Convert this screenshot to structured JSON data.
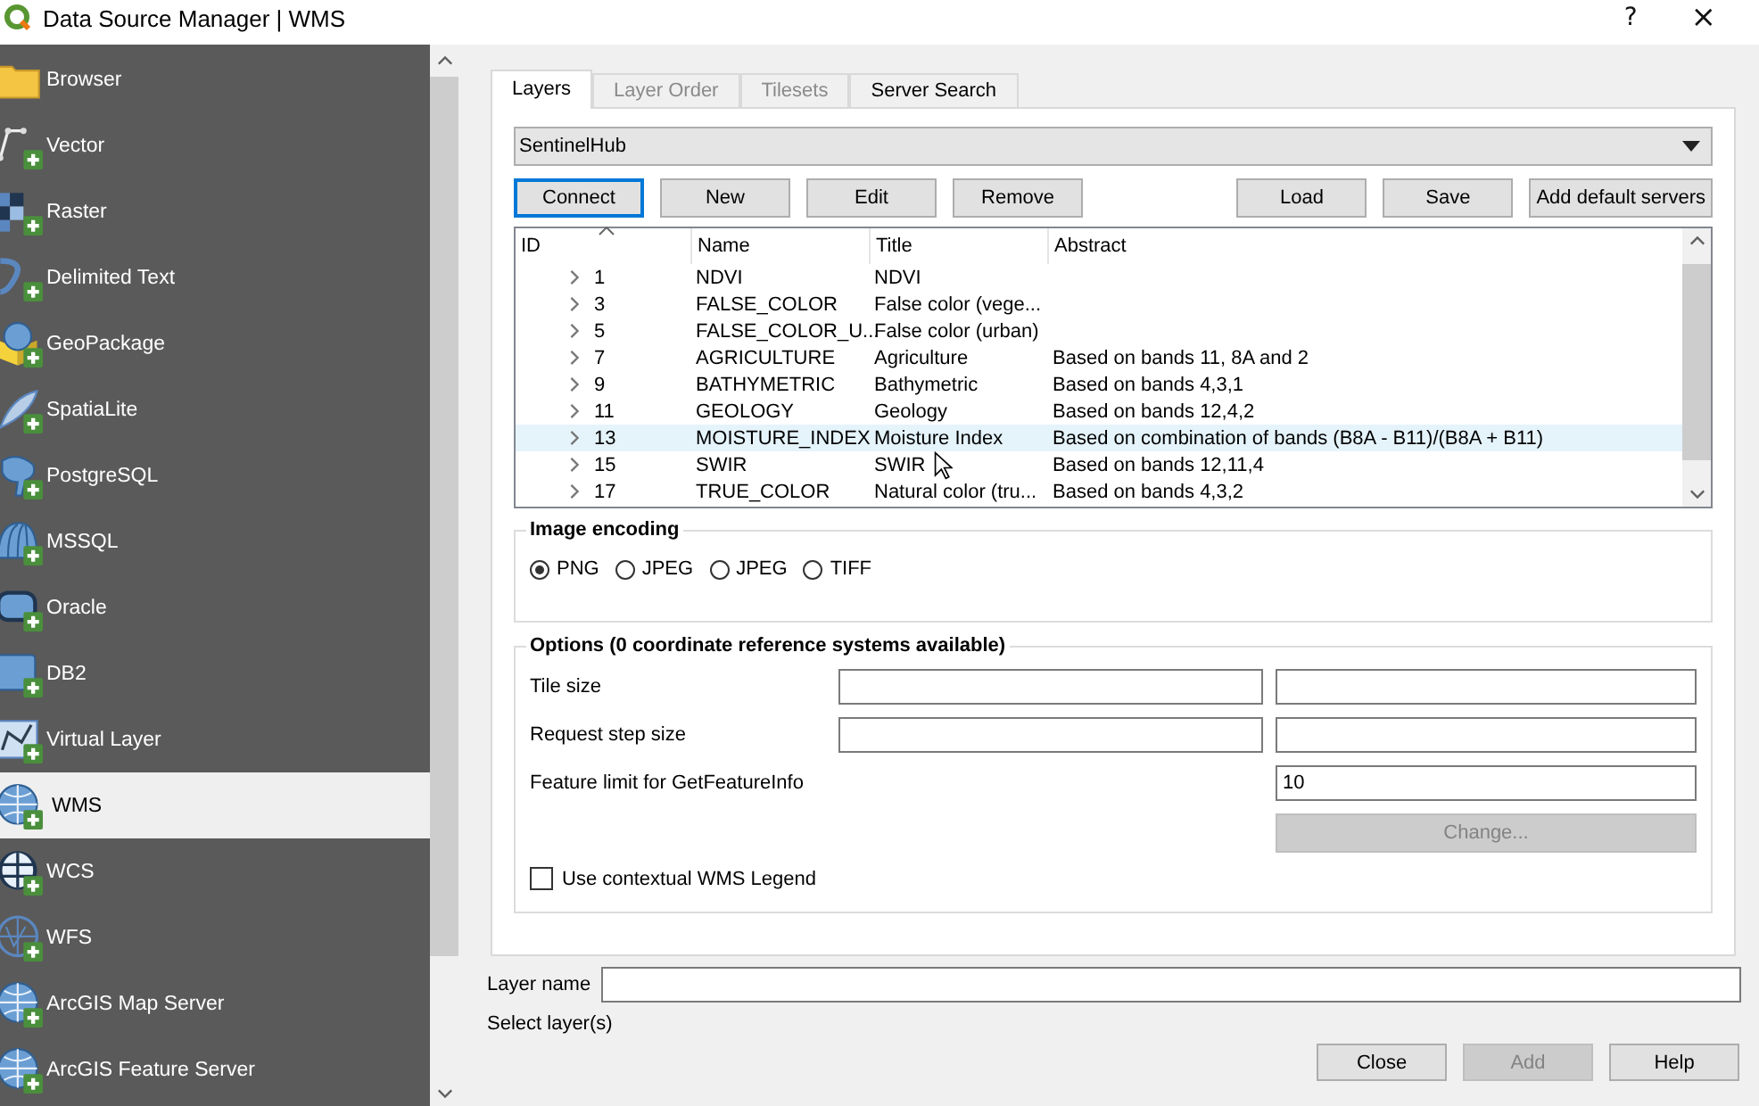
{
  "window": {
    "title": "Data Source Manager | WMS",
    "help": "?",
    "close": "×"
  },
  "sidebar": {
    "items": [
      {
        "label": "Browser",
        "selected": false
      },
      {
        "label": "Vector",
        "selected": false
      },
      {
        "label": "Raster",
        "selected": false
      },
      {
        "label": "Delimited Text",
        "selected": false
      },
      {
        "label": "GeoPackage",
        "selected": false
      },
      {
        "label": "SpatiaLite",
        "selected": false
      },
      {
        "label": "PostgreSQL",
        "selected": false
      },
      {
        "label": "MSSQL",
        "selected": false
      },
      {
        "label": "Oracle",
        "selected": false
      },
      {
        "label": "DB2",
        "selected": false
      },
      {
        "label": "Virtual Layer",
        "selected": false
      },
      {
        "label": "WMS",
        "selected": true
      },
      {
        "label": "WCS",
        "selected": false
      },
      {
        "label": "WFS",
        "selected": false
      },
      {
        "label": "ArcGIS Map Server",
        "selected": false
      },
      {
        "label": "ArcGIS Feature Server",
        "selected": false
      }
    ]
  },
  "tabs": [
    {
      "label": "Layers",
      "selected": true,
      "disabled": false
    },
    {
      "label": "Layer Order",
      "selected": false,
      "disabled": true
    },
    {
      "label": "Tilesets",
      "selected": false,
      "disabled": true
    },
    {
      "label": "Server Search",
      "selected": false,
      "disabled": false
    }
  ],
  "connection": {
    "value": "SentinelHub"
  },
  "connection_buttons": [
    {
      "label": "Connect",
      "focused": true
    },
    {
      "label": "New",
      "focused": false
    },
    {
      "label": "Edit",
      "focused": false
    },
    {
      "label": "Remove",
      "focused": false
    }
  ],
  "server_buttons": [
    {
      "label": "Load",
      "focused": false
    },
    {
      "label": "Save",
      "focused": false
    },
    {
      "label": "Add default servers",
      "focused": false
    }
  ],
  "layers_table": {
    "columns": [
      "ID",
      "Name",
      "Title",
      "Abstract"
    ],
    "rows": [
      {
        "id": "1",
        "name": "NDVI",
        "title": "NDVI",
        "selected": false
      },
      {
        "id": "3",
        "name": "FALSE_COLOR",
        "title": "False color (vege...",
        "selected": false
      },
      {
        "id": "5",
        "name": "FALSE_COLOR_U...",
        "title": "False color (urban)",
        "selected": false
      },
      {
        "id": "7",
        "name": "AGRICULTURE",
        "title": "Agriculture",
        "abstract": "Based on bands 11, 8A and 2",
        "selected": false
      },
      {
        "id": "9",
        "name": "BATHYMETRIC",
        "title": "Bathymetric",
        "abstract": "Based on bands 4,3,1",
        "selected": false
      },
      {
        "id": "11",
        "name": "GEOLOGY",
        "title": "Geology",
        "abstract": "Based on bands 12,4,2",
        "selected": false
      },
      {
        "id": "13",
        "name": "MOISTURE_INDEX",
        "title": "Moisture Index",
        "abstract": "Based on combination of bands (B8A - B11)/(B8A + B11)",
        "selected": true
      },
      {
        "id": "15",
        "name": "SWIR",
        "title": "SWIR",
        "abstract": "Based on bands 12,11,4",
        "selected": false
      },
      {
        "id": "17",
        "name": "TRUE_COLOR",
        "title": "Natural color (tru...",
        "abstract": "Based on bands 4,3,2",
        "selected": false
      }
    ]
  },
  "image_encoding": {
    "title": "Image encoding",
    "options": [
      {
        "label": "PNG",
        "selected": true
      },
      {
        "label": "JPEG",
        "selected": false
      },
      {
        "label": "JPEG",
        "selected": false
      },
      {
        "label": "TIFF",
        "selected": false
      }
    ]
  },
  "options": {
    "title": "Options (0 coordinate reference systems available)",
    "tile_size_label": "Tile size",
    "request_step_label": "Request step size",
    "feature_limit_label": "Feature limit for GetFeatureInfo",
    "feature_limit_value": "10",
    "change_button": {
      "label": "Change...",
      "disabled": true
    },
    "legend": {
      "label": "Use contextual WMS Legend",
      "checked": false
    }
  },
  "layer_name": {
    "label": "Layer name"
  },
  "status": "Select layer(s)",
  "dialog_buttons": [
    {
      "label": "Close",
      "disabled": false
    },
    {
      "label": "Add",
      "disabled": true
    },
    {
      "label": "Help",
      "disabled": false
    }
  ]
}
